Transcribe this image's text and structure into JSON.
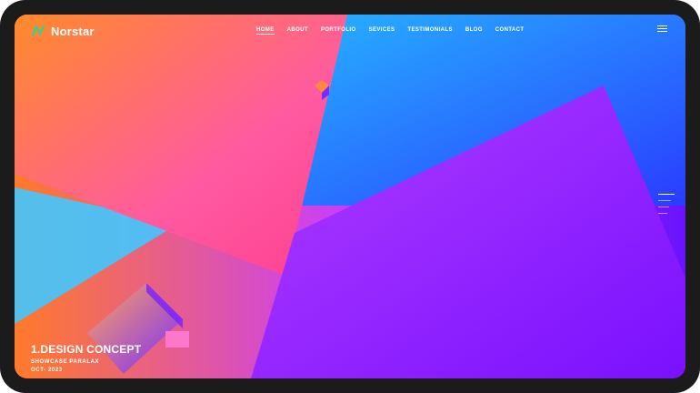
{
  "brand": {
    "name": "Norstar",
    "logo_icon": "n-logo-icon"
  },
  "nav": [
    {
      "label": "HOME",
      "active": true
    },
    {
      "label": "ABOUT",
      "active": false
    },
    {
      "label": "PORTFOLIO",
      "active": false
    },
    {
      "label": "SEVICES",
      "active": false
    },
    {
      "label": "TESTIMONIALS",
      "active": false
    },
    {
      "label": "BLOG",
      "active": false
    },
    {
      "label": "CONTACT",
      "active": false
    }
  ],
  "slide": {
    "title": "1.DESIGN CONCEPT",
    "subtitle": "SHOWCASE PARALAX",
    "date": "OCT- 2023"
  },
  "colors": {
    "accent": "#2bd48f",
    "orange": "#ff7a2a",
    "pink": "#ff5ea8",
    "purple": "#9c3bff",
    "blue": "#2a3cff",
    "violet": "#6a12ff"
  }
}
